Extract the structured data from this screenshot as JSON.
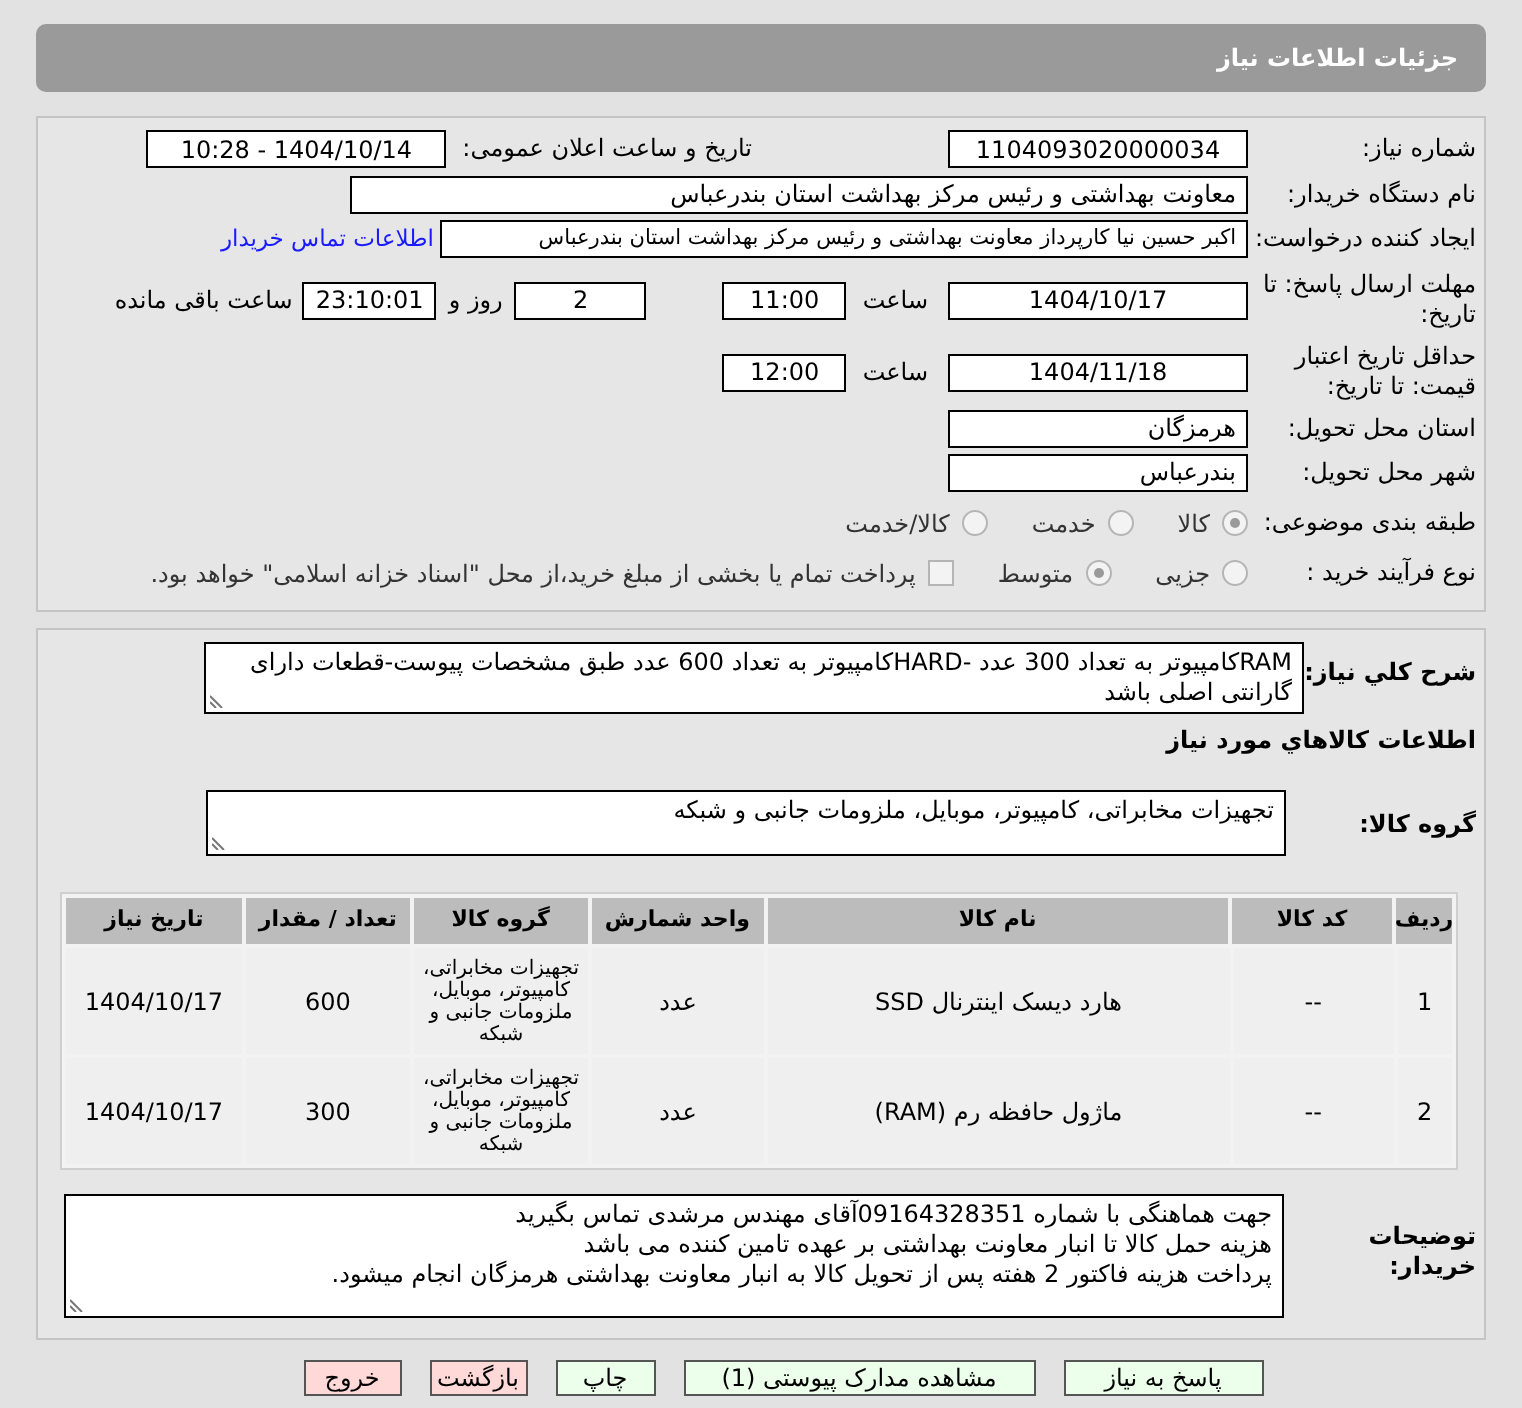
{
  "header": {
    "title": "جزئیات اطلاعات نیاز"
  },
  "need_number": {
    "label": "شماره نیاز:",
    "value": "1104093020000034"
  },
  "announce": {
    "label": "تاریخ و ساعت اعلان عمومی:",
    "value": "1404/10/14 - 10:28"
  },
  "buyer_org": {
    "label": "نام دستگاه خریدار:",
    "value": "معاونت  بهداشتی و رئیس مرکز بهداشت استان بندرعباس"
  },
  "requester": {
    "label": "ایجاد کننده درخواست:",
    "value": "اکبر حسین نیا کارپرداز معاونت  بهداشتی و رئیس مرکز بهداشت استان بندرعباس",
    "link": "اطلاعات تماس خریدار"
  },
  "response_deadline": {
    "label": "مهلت ارسال پاسخ: تا تاریخ:",
    "date": "1404/10/17",
    "time_label": "ساعت",
    "time": "11:00",
    "days": "2",
    "days_label": "روز و",
    "remaining": "23:10:01",
    "remaining_label": "ساعت باقی مانده"
  },
  "price_validity": {
    "label": "حداقل تاریخ اعتبار قیمت: تا تاریخ:",
    "date": "1404/11/18",
    "time_label": "ساعت",
    "time": "12:00"
  },
  "province": {
    "label": "استان محل تحویل:",
    "value": "هرمزگان"
  },
  "city": {
    "label": "شهر محل تحویل:",
    "value": "بندرعباس"
  },
  "category": {
    "label": "طبقه بندی موضوعی:",
    "options": [
      {
        "label": "کالا",
        "selected": true
      },
      {
        "label": "خدمت",
        "selected": false
      },
      {
        "label": "کالا/خدمت",
        "selected": false
      }
    ]
  },
  "process": {
    "label": "نوع فرآیند خرید :",
    "options": [
      {
        "label": "جزیی",
        "selected": false
      },
      {
        "label": "متوسط",
        "selected": true
      }
    ],
    "treasury": {
      "label": "پرداخت تمام یا بخشی از مبلغ خرید،از محل \"اسناد خزانه اسلامی\" خواهد بود.",
      "checked": false
    }
  },
  "description": {
    "label": "شرح کلي نياز:",
    "value": "RAMکامپیوتر به تعداد 300 عدد -HARDکامپیوتر به تعداد 600 عدد طبق مشخصات پیوست-قطعات دارای گارانتی اصلی باشد"
  },
  "goods_title": "اطلاعات کالاهاي مورد نياز",
  "goods_group": {
    "label": "گروه کالا:",
    "value": "تجهیزات مخابراتی، کامپیوتر، موبایل، ملزومات جانبی و شبکه"
  },
  "table": {
    "columns": [
      "ردیف",
      "کد کالا",
      "نام کالا",
      "واحد شمارش",
      "گروه کالا",
      "تعداد / مقدار",
      "تاریخ نیاز"
    ],
    "rows": [
      [
        "1",
        "--",
        "هارد دیسک اینترنال SSD",
        "عدد",
        "تجهیزات مخابراتی، کامپیوتر، موبایل، ملزومات جانبی و شبکه",
        "600",
        "1404/10/17"
      ],
      [
        "2",
        "--",
        "ماژول حافظه رم (RAM)",
        "عدد",
        "تجهیزات مخابراتی، کامپیوتر، موبایل، ملزومات جانبی و شبکه",
        "300",
        "1404/10/17"
      ]
    ]
  },
  "buyer_notes": {
    "label": "توضیحات خریدار:",
    "lines": [
      "جهت هماهنگی با شماره 09164328351آقای مهندس مرشدی تماس بگیرید",
      "هزینه حمل کالا تا انبار  معاونت بهداشتی بر عهده تامین کننده می باشد",
      "پرداخت هزینه فاکتور 2 هفته پس از تحویل کالا به انبار معاونت بهداشتی هرمزگان انجام میشود."
    ]
  },
  "buttons": [
    {
      "label": "پاسخ به نیاز",
      "kind": "action"
    },
    {
      "label": "مشاهده مدارک پیوستی (1)",
      "kind": "action"
    },
    {
      "label": "چاپ",
      "kind": "action"
    },
    {
      "label": "بازگشت",
      "kind": "exit"
    },
    {
      "label": "خروج",
      "kind": "exit"
    }
  ]
}
